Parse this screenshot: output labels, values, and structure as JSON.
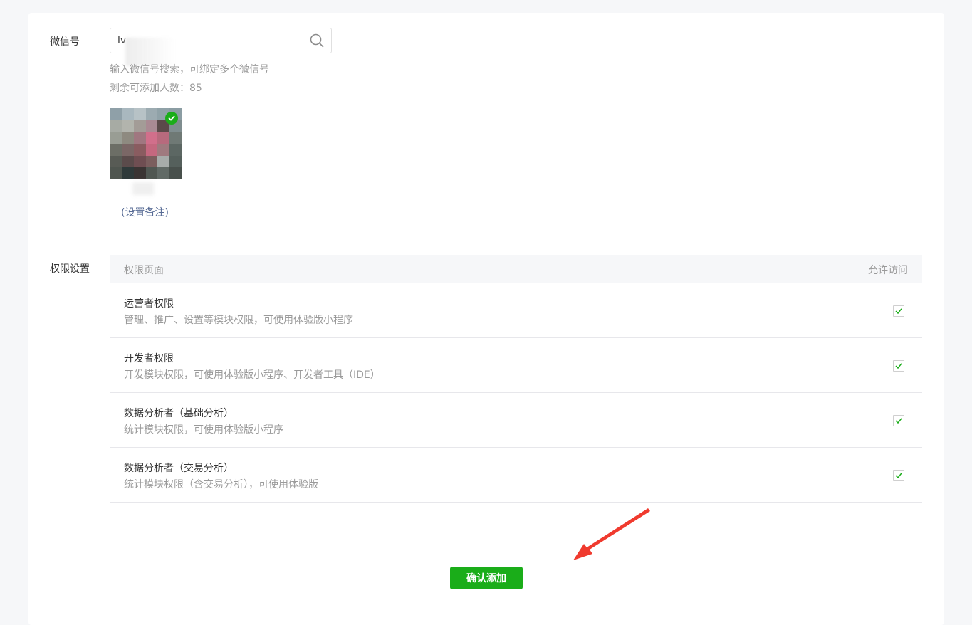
{
  "wechat": {
    "label": "微信号",
    "search_value": "lv",
    "hint": "输入微信号搜索，可绑定多个微信号",
    "remaining": "剩余可添加人数：85",
    "remark_link": "(设置备注)"
  },
  "permissions": {
    "label": "权限设置",
    "col_page": "权限页面",
    "col_access": "允许访问",
    "rows": [
      {
        "title": "运营者权限",
        "desc": "管理、推广、设置等模块权限，可使用体验版小程序",
        "checked": true
      },
      {
        "title": "开发者权限",
        "desc": "开发模块权限，可使用体验版小程序、开发者工具（IDE）",
        "checked": true
      },
      {
        "title": "数据分析者（基础分析）",
        "desc": "统计模块权限，可使用体验版小程序",
        "checked": true
      },
      {
        "title": "数据分析者（交易分析）",
        "desc": "统计模块权限（含交易分析），可使用体验版",
        "checked": true
      }
    ]
  },
  "confirm_label": "确认添加",
  "colors": {
    "accent": "#1aad19",
    "link": "#576b95",
    "annotation_arrow": "#f03a2e"
  },
  "icons": {
    "search": "search-icon",
    "selected": "check-circle-icon",
    "checkbox": "checkmark-icon"
  }
}
